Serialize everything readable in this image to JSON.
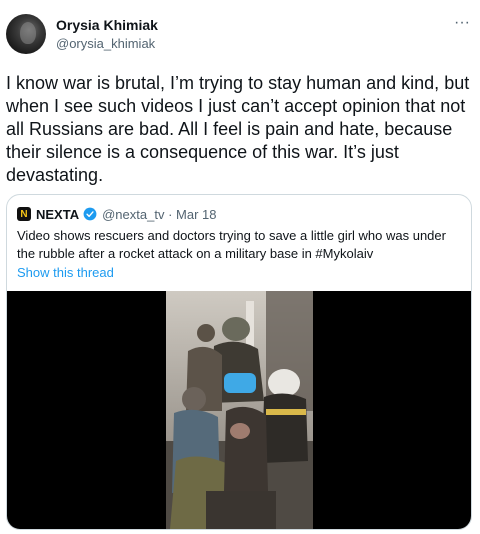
{
  "author": {
    "name": "Orysia Khimiak",
    "handle": "@orysia_khimiak"
  },
  "more_label": "···",
  "tweet_text": "I know war is brutal, I’m trying to stay human and kind, but when I see such videos I just can’t accept opinion that not all Russians are bad. All I feel is pain and hate, because their silence is a consequence of this war. It’s just devastating.",
  "quoted": {
    "logo_letter": "N",
    "name": "NEXTA",
    "handle": "@nexta_tv",
    "date": "Mar 18",
    "text": "Video shows rescuers and doctors trying to save a little girl who was under the rubble after a rocket attack on a military base in #Mykolaiv",
    "show_thread": "Show this thread",
    "verified_color": "#1d9bf0"
  },
  "colors": {
    "text": "#0f1419",
    "secondary": "#536471",
    "link": "#1d9bf0",
    "border": "#cfd9de"
  }
}
